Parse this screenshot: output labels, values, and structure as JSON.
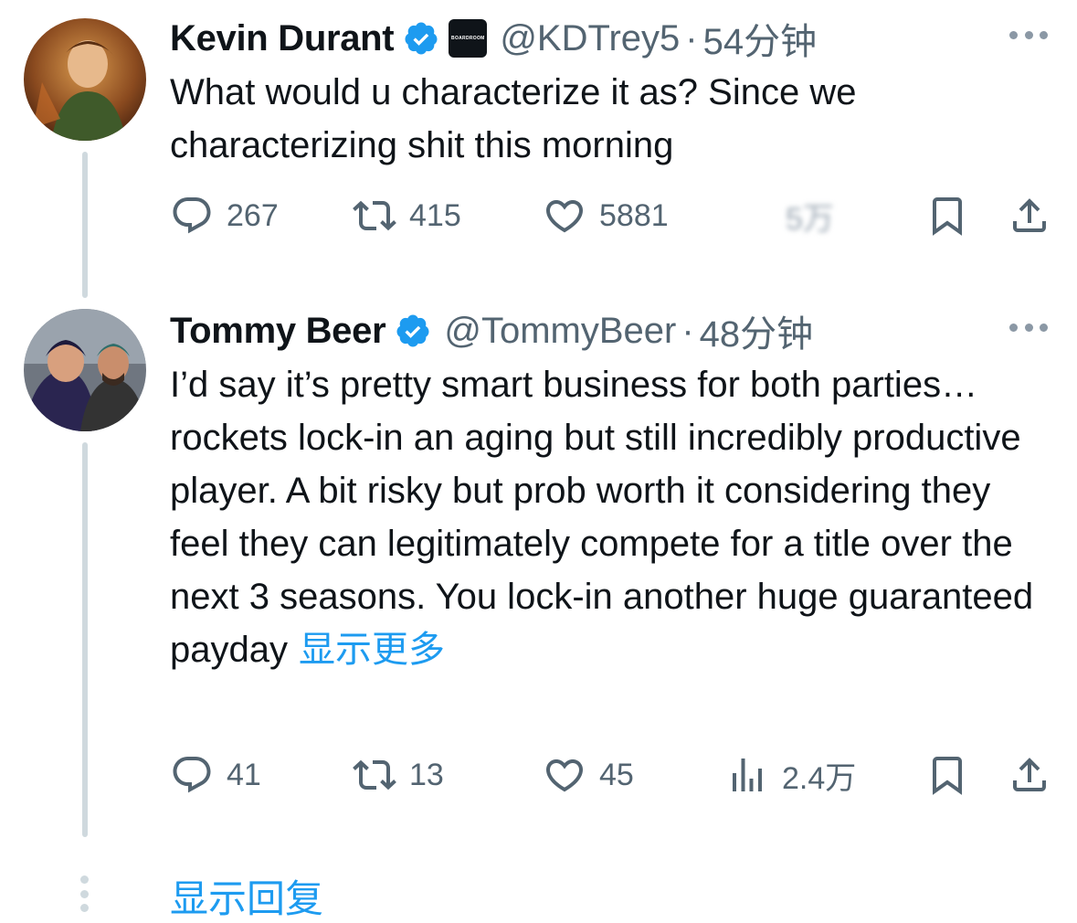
{
  "tweets": [
    {
      "author": "Kevin Durant",
      "handle": "@KDTrey5",
      "separator": "·",
      "time": "54分钟",
      "affiliation_badge": "BOARDROOM",
      "text": "What would u characterize it as? Since we characterizing shit this morning",
      "show_more": "",
      "stats": {
        "replies": "267",
        "retweets": "415",
        "likes": "5881",
        "views": "5万"
      },
      "avatar_icon": "avatar-image",
      "verified": true
    },
    {
      "author": "Tommy Beer",
      "handle": "@TommyBeer",
      "separator": "·",
      "time": "48分钟",
      "text": "I’d say it’s pretty smart business for both parties… rockets lock-in an aging but still incredibly productive player. A bit risky but prob worth it considering they feel they can legitimately compete for a title over the next 3 seasons. You lock-in another huge guaranteed payday",
      "show_more": "显示更多",
      "stats": {
        "replies": "41",
        "retweets": "13",
        "likes": "45",
        "views": "2.4万"
      },
      "avatar_icon": "avatar-image",
      "verified": true
    }
  ],
  "show_replies": "显示回复",
  "colors": {
    "accent": "#1d9bf0",
    "muted": "#536471",
    "text": "#0f1419",
    "line": "#cfd9de"
  },
  "icons": [
    "verified-icon",
    "more-icon",
    "reply-icon",
    "retweet-icon",
    "like-icon",
    "views-icon",
    "bookmark-icon",
    "share-icon"
  ]
}
